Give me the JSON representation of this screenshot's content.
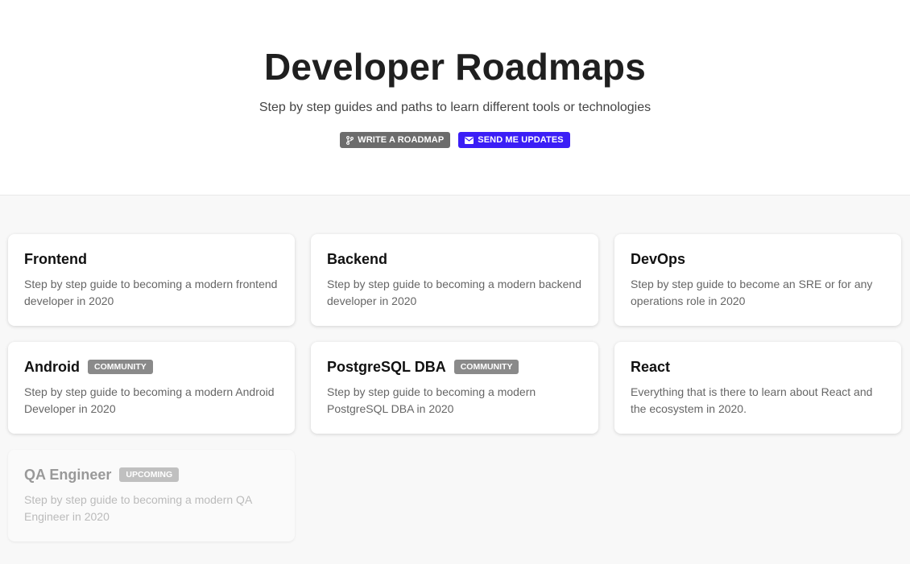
{
  "hero": {
    "title": "Developer Roadmaps",
    "subtitle": "Step by step guides and paths to learn different tools or technologies",
    "write_button": {
      "label": "WRITE A ROADMAP",
      "icon": "git-branch-icon",
      "color": "#6c6c6c"
    },
    "updates_button": {
      "label": "SEND ME UPDATES",
      "icon": "envelope-icon",
      "color": "#3b1ef6"
    }
  },
  "roadmaps": [
    {
      "title": "Frontend",
      "description": "Step by step guide to becoming a modern frontend developer in 2020",
      "badge": ""
    },
    {
      "title": "Backend",
      "description": "Step by step guide to becoming a modern backend developer in 2020",
      "badge": ""
    },
    {
      "title": "DevOps",
      "description": "Step by step guide to become an SRE or for any operations role in 2020",
      "badge": ""
    },
    {
      "title": "Android",
      "description": "Step by step guide to becoming a modern Android Developer in 2020",
      "badge": "COMMUNITY"
    },
    {
      "title": "PostgreSQL DBA",
      "description": "Step by step guide to becoming a modern PostgreSQL DBA in 2020",
      "badge": "COMMUNITY"
    },
    {
      "title": "React",
      "description": "Everything that is there to learn about React and the ecosystem in 2020.",
      "badge": ""
    },
    {
      "title": "QA Engineer",
      "description": "Step by step guide to becoming a modern QA Engineer in 2020",
      "badge": "UPCOMING"
    }
  ]
}
